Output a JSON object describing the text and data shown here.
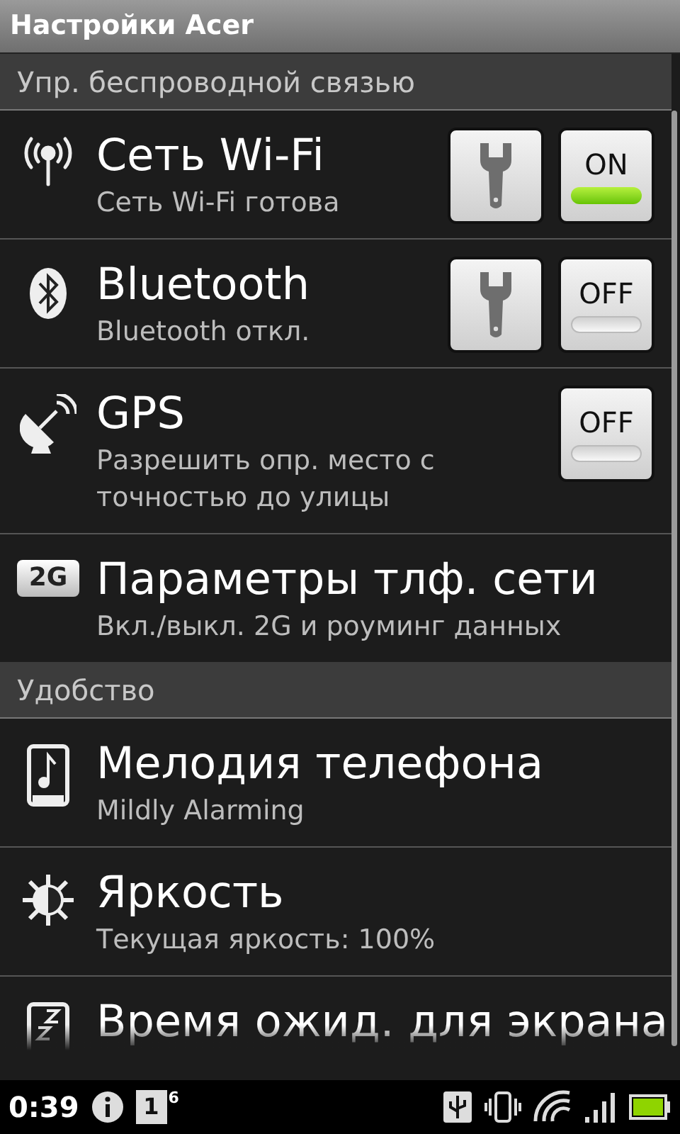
{
  "title_bar": {
    "title": "Настройки Acer"
  },
  "sections": [
    {
      "header": "Упр. беспроводной связью",
      "items": [
        {
          "kind": "wifi",
          "title": "Сеть Wi-Fi",
          "summary": "Сеть Wi-Fi готова",
          "settings_button": true,
          "toggle": {
            "label": "ON",
            "on": true
          }
        },
        {
          "kind": "bluetooth",
          "title": "Bluetooth",
          "summary": "Bluetooth откл.",
          "settings_button": true,
          "toggle": {
            "label": "OFF",
            "on": false
          }
        },
        {
          "kind": "gps",
          "title": "GPS",
          "summary": "Разрешить опр. место с точностью до улицы",
          "settings_button": false,
          "toggle": {
            "label": "OFF",
            "on": false
          }
        },
        {
          "kind": "network",
          "badge": "2G",
          "title": "Параметры тлф. сети",
          "summary": "Вкл./выкл. 2G и роуминг данных"
        }
      ]
    },
    {
      "header": "Удобство",
      "items": [
        {
          "kind": "ringtone",
          "title": "Мелодия телефона",
          "summary": "Mildly Alarming"
        },
        {
          "kind": "brightness",
          "title": "Яркость",
          "summary": "Текущая яркость: 100%"
        },
        {
          "kind": "sleep",
          "title": "Время ожид. для экрана",
          "cut": true
        }
      ]
    }
  ],
  "status_bar": {
    "time": "0:39",
    "calendar_day": "1",
    "notification_count": "6"
  }
}
